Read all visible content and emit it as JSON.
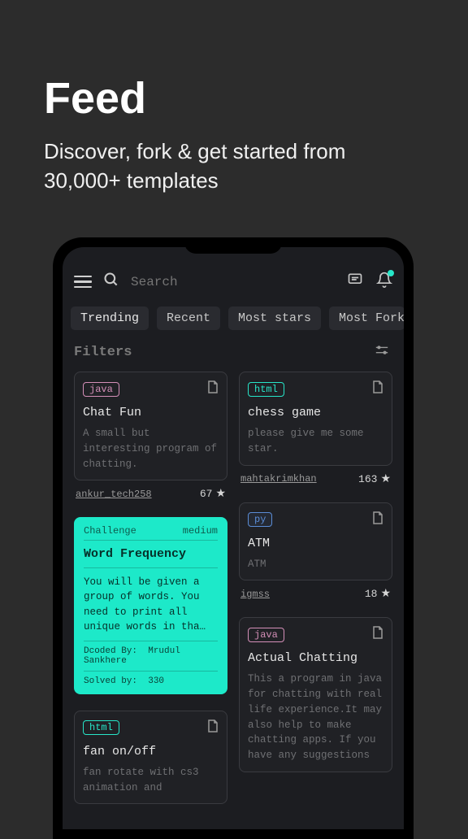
{
  "hero": {
    "title": "Feed",
    "subtitle": "Discover, fork & get started from 30,000+ templates"
  },
  "search": {
    "placeholder": "Search"
  },
  "tabs": [
    "Trending",
    "Recent",
    "Most stars",
    "Most Fork"
  ],
  "filters_label": "Filters",
  "cards": {
    "chat_fun": {
      "lang": "java",
      "title": "Chat Fun",
      "desc": "A small but interesting program of chatting.",
      "author": "ankur_tech258",
      "stars": "67"
    },
    "chess": {
      "lang": "html",
      "title": "chess game",
      "desc": "please give me some star.",
      "author": "mahtakrimkhan",
      "stars": "163"
    },
    "atm": {
      "lang": "py",
      "title": "ATM",
      "desc": "ATM",
      "author": "igmss",
      "stars": "18"
    },
    "fan": {
      "lang": "html",
      "title": "fan on/off",
      "desc": "fan rotate with cs3 animation and"
    },
    "actual_chat": {
      "lang": "java",
      "title": "Actual Chatting",
      "desc": "This a program in java for chatting with real life experience.It may also help to make chatting apps. If you have any suggestions"
    }
  },
  "challenge": {
    "label": "Challenge",
    "difficulty": "medium",
    "title": "Word Frequency",
    "desc": "You will be given a group of words. You need to print all unique words in tha…",
    "dcoded_label": "Dcoded By:",
    "dcoded_by": "Mrudul Sankhere",
    "solved_label": "Solved by:",
    "solved_by": "330"
  }
}
